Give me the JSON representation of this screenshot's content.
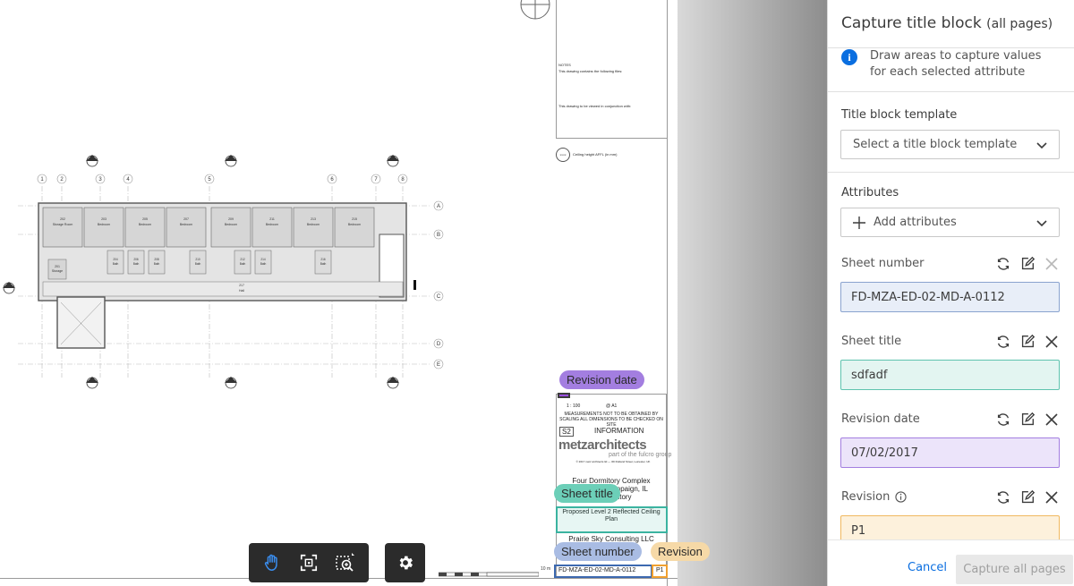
{
  "panel": {
    "title": "Capture title block",
    "title_suffix": "(all pages)",
    "info_text": "Draw areas to capture values for each selected attribute",
    "template_section_label": "Title block template",
    "template_placeholder": "Select a title block template",
    "attributes_section_label": "Attributes",
    "add_attributes_label": "Add attributes",
    "attributes": [
      {
        "label": "Sheet number",
        "value": "FD-MZA-ED-02-MD-A-0112",
        "color": "#e8eef8",
        "border": "#8aa3cf",
        "removable": false,
        "info": false
      },
      {
        "label": "Sheet title",
        "value": "sdfadf",
        "color": "#e3f5f1",
        "border": "#5ec3ae",
        "removable": true,
        "info": false
      },
      {
        "label": "Revision date",
        "value": "07/02/2017",
        "color": "#ece4fa",
        "border": "#a37ee0",
        "removable": true,
        "info": false
      },
      {
        "label": "Revision",
        "value": "P1",
        "color": "#fdf1dc",
        "border": "#f0b860",
        "removable": true,
        "info": true
      }
    ],
    "cancel_label": "Cancel",
    "capture_label": "Capture all pages"
  },
  "pills": {
    "revision_date": "Revision date",
    "sheet_title": "Sheet title",
    "sheet_number": "Sheet number",
    "revision": "Revision"
  },
  "sheet": {
    "notes_head": "NOTES",
    "notes_line1": "This drawing contains the following files:",
    "notes_line2": "This drawing to be viewed in conjunction with:",
    "ceiling_symbol": "xxxx",
    "ceiling_note": "Ceiling height AFFL (in mm)",
    "scale": "1 : 100",
    "paper_size": "@ A1",
    "measurements": "MEASUREMENTS NOT TO BE OBTAINED BY SCALING ALL DIMENSIONS TO BE CHECKED ON SITE",
    "status_code": "S2",
    "status_text": "INFORMATION",
    "logo": "metzarchitects",
    "logo_sub": "part of the fulcro group",
    "copyright": "© 2017 metz architects ltd — 3D Rutland Street, Leicester, UK",
    "project_line1": "Four Dormitory Complex",
    "project_line2": "ampaign, IL",
    "project_line3": "itory",
    "drawing_title": "Proposed Level 2 Reflected Ceiling Plan",
    "client": "Prairie Sky Consulting LLC",
    "drawing_number": "FD-MZA-ED-02-MD-A-0112",
    "revision": "P1",
    "scale_bar_label": "10 m",
    "scale_bar_ticks": [
      "0",
      "1",
      "2",
      "3",
      "4",
      "5"
    ]
  },
  "plan": {
    "grid_numbers": [
      "1",
      "2",
      "3",
      "4",
      "5",
      "6",
      "7",
      "8"
    ],
    "grid_letters": [
      "A",
      "B",
      "C",
      "D",
      "E"
    ],
    "room_numbers_top": [
      "202",
      "203",
      "205",
      "207",
      "209",
      "211",
      "213",
      "215"
    ],
    "room_names_top": [
      "Storage Room",
      "Bedroom",
      "Bedroom",
      "Bedroom",
      "Bedroom",
      "Bedroom",
      "Bedroom",
      "Bedroom"
    ],
    "bath_numbers": [
      "204",
      "206",
      "208",
      "210",
      "212",
      "214",
      "216"
    ],
    "bath_name": "Bath",
    "storage_number": "201",
    "storage_name": "Storage",
    "hall_number": "217",
    "hall_name": "Hall"
  },
  "toolbar": {
    "tools": [
      "pan-icon",
      "fit-view-icon",
      "zoom-region-icon"
    ],
    "settings": "gear-icon"
  }
}
